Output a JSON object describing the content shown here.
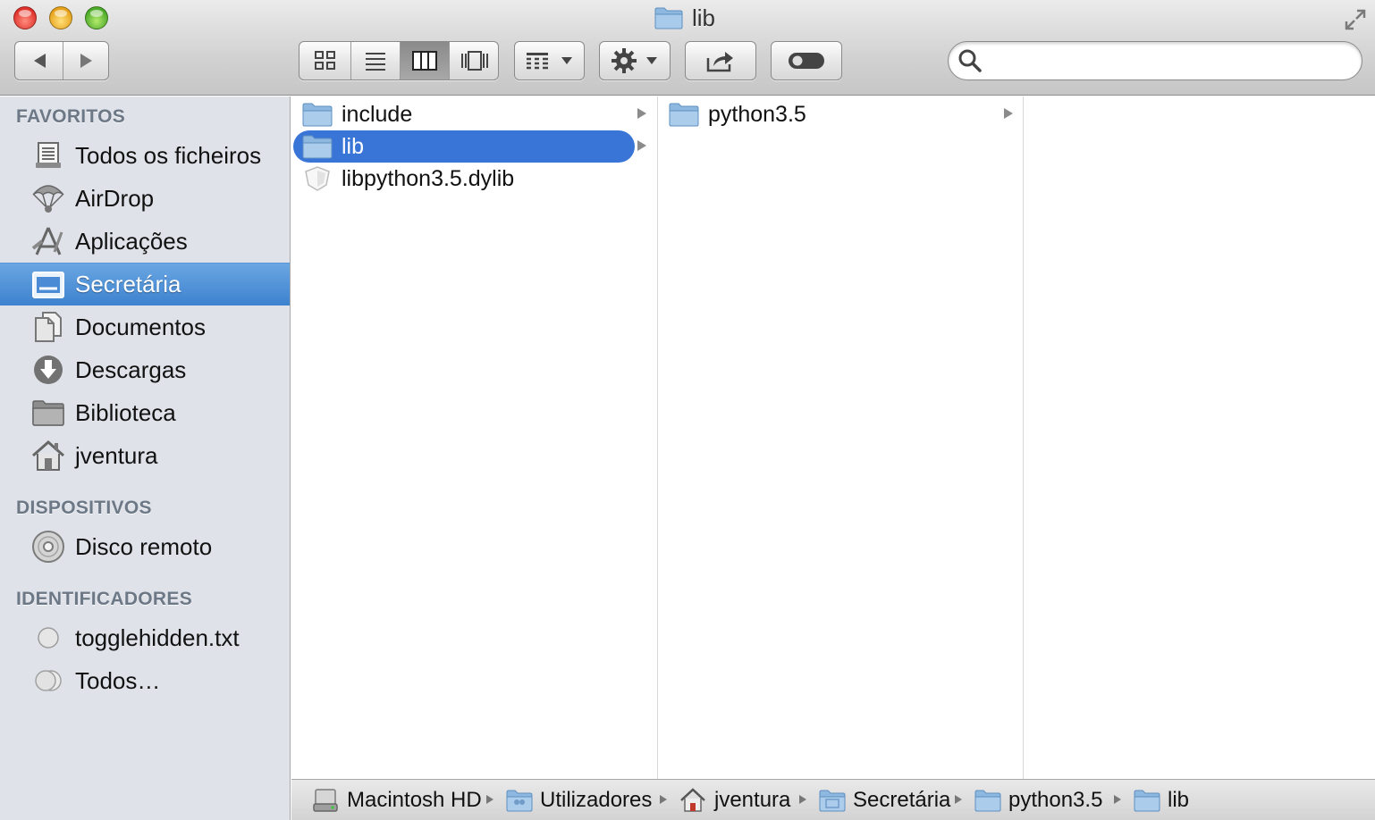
{
  "window": {
    "title": "lib",
    "search": {
      "value": "",
      "placeholder": ""
    }
  },
  "sidebar": {
    "sections": [
      {
        "heading": "FAVORITOS"
      },
      {
        "heading": "DISPOSITIVOS"
      },
      {
        "heading": "IDENTIFICADORES"
      }
    ],
    "favorites": [
      {
        "label": "Todos os ficheiros",
        "icon": "all-files-icon"
      },
      {
        "label": "AirDrop",
        "icon": "airdrop-icon"
      },
      {
        "label": "Aplicações",
        "icon": "applications-icon"
      },
      {
        "label": "Secretária",
        "icon": "desktop-icon",
        "selected": true
      },
      {
        "label": "Documentos",
        "icon": "documents-icon"
      },
      {
        "label": "Descargas",
        "icon": "downloads-icon"
      },
      {
        "label": "Biblioteca",
        "icon": "folder-icon"
      },
      {
        "label": "jventura",
        "icon": "home-icon"
      }
    ],
    "devices": [
      {
        "label": "Disco remoto",
        "icon": "remote-disc-icon"
      }
    ],
    "tags": [
      {
        "label": "togglehidden.txt",
        "icon": "tag-circle-icon"
      },
      {
        "label": "Todos…",
        "icon": "all-tags-icon"
      }
    ]
  },
  "columns": [
    {
      "items": [
        {
          "label": "include",
          "icon": "folder-icon",
          "has_children": true
        },
        {
          "label": "lib",
          "icon": "folder-icon",
          "has_children": true,
          "selected": true
        },
        {
          "label": "libpython3.5.dylib",
          "icon": "dylib-file-icon",
          "has_children": false
        }
      ]
    },
    {
      "items": [
        {
          "label": "python3.5",
          "icon": "folder-icon",
          "has_children": true
        }
      ]
    },
    {
      "items": []
    }
  ],
  "pathbar": [
    {
      "label": "Macintosh HD",
      "icon": "hard-drive-icon"
    },
    {
      "label": "Utilizadores",
      "icon": "users-folder-icon"
    },
    {
      "label": "jventura",
      "icon": "home-icon"
    },
    {
      "label": "Secretária",
      "icon": "desktop-folder-icon"
    },
    {
      "label": "python3.5",
      "icon": "folder-icon"
    },
    {
      "label": "lib",
      "icon": "folder-icon"
    }
  ],
  "colors": {
    "selection": "#3875d7",
    "sidebar_selection": "#4a8ad6",
    "sidebar_bg": "#dfe3e9",
    "folder": "#8fb8e0"
  }
}
